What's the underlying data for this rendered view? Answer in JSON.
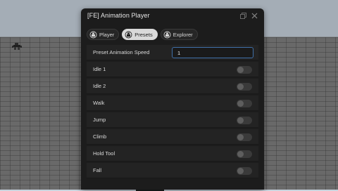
{
  "window": {
    "title": "[FE] Animation Player",
    "icons": {
      "restore": "restore-icon",
      "close": "close-icon"
    }
  },
  "tabs": [
    {
      "label": "Player",
      "icon": "character-icon",
      "active": false
    },
    {
      "label": "Presets",
      "icon": "character-icon",
      "active": true
    },
    {
      "label": "Explorer",
      "icon": "character-icon",
      "active": false
    }
  ],
  "speed": {
    "label": "Preset Animation Speed",
    "value": "1"
  },
  "presets": [
    {
      "label": "Idle 1",
      "on": false
    },
    {
      "label": "Idle 2",
      "on": false
    },
    {
      "label": "Walk",
      "on": false
    },
    {
      "label": "Jump",
      "on": false
    },
    {
      "label": "Climb",
      "on": false
    },
    {
      "label": "Hold Tool",
      "on": false
    },
    {
      "label": "Fall",
      "on": false
    }
  ],
  "colors": {
    "accent": "#3f6fa8",
    "panel": "#1c1c1c",
    "row": "#232323",
    "active_tab": "#d9d9d9"
  }
}
